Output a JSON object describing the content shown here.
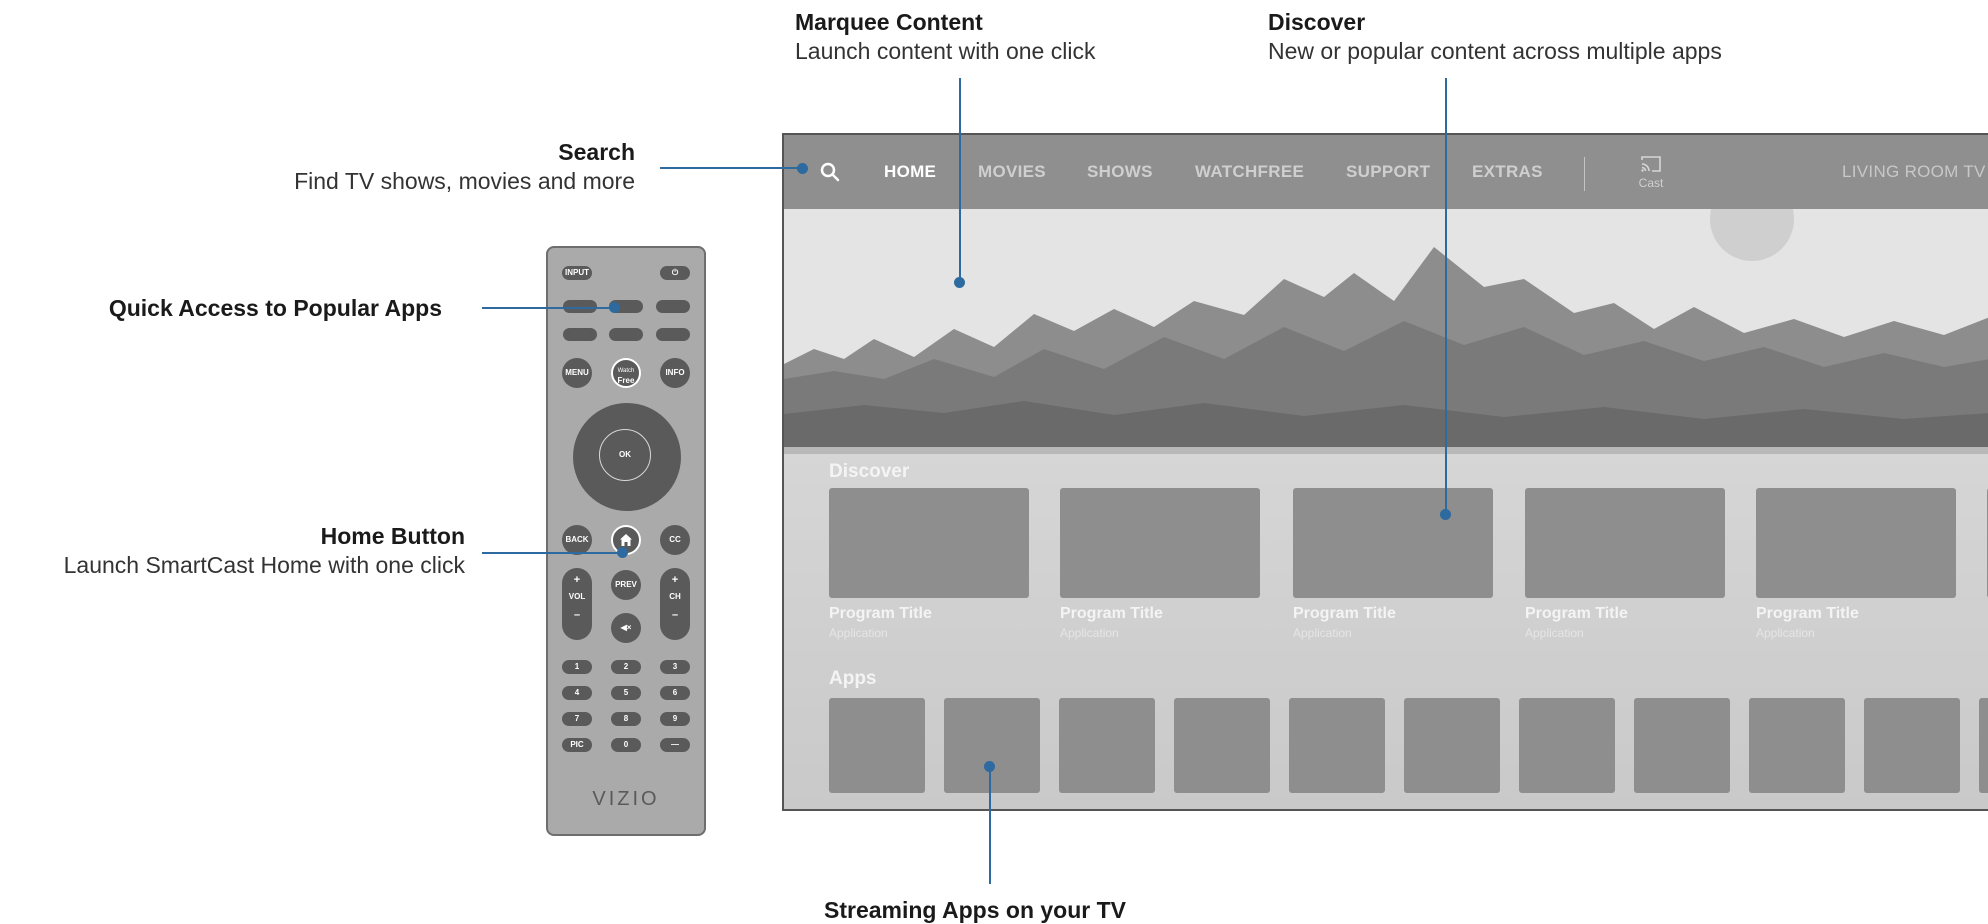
{
  "callouts": {
    "marquee": {
      "title": "Marquee Content",
      "subtitle": "Launch content with one click"
    },
    "discover": {
      "title": "Discover",
      "subtitle": "New or popular content across multiple apps"
    },
    "search": {
      "title": "Search",
      "subtitle": "Find TV shows, movies and more"
    },
    "quick_access": {
      "title": "Quick Access to Popular Apps"
    },
    "home_button": {
      "title": "Home Button",
      "subtitle": "Launch SmartCast Home with one click"
    },
    "streaming_apps": {
      "title": "Streaming Apps on your TV"
    }
  },
  "tv": {
    "nav": {
      "items": [
        "HOME",
        "MOVIES",
        "SHOWS",
        "WATCHFREE",
        "SUPPORT",
        "EXTRAS"
      ],
      "active": "HOME",
      "cast_label": "Cast",
      "device_name": "LIVING ROOM TV"
    },
    "discover": {
      "label": "Discover",
      "cards": [
        {
          "title": "Program Title",
          "app": "Application"
        },
        {
          "title": "Program Title",
          "app": "Application"
        },
        {
          "title": "Program Title",
          "app": "Application"
        },
        {
          "title": "Program Title",
          "app": "Application"
        },
        {
          "title": "Program Title",
          "app": "Application"
        }
      ]
    },
    "apps": {
      "label": "Apps"
    }
  },
  "remote": {
    "input": "INPUT",
    "power": "⏻",
    "menu": "MENU",
    "watchfree_top": "Watch",
    "watchfree_bottom": "Free",
    "info": "INFO",
    "ok": "OK",
    "back": "BACK",
    "cc": "CC",
    "prev": "PREV",
    "vol_plus": "+",
    "vol": "VOL",
    "vol_minus": "–",
    "ch_plus": "+",
    "ch": "CH",
    "ch_minus": "–",
    "mute": "◀×",
    "keys": [
      "1",
      "2",
      "3",
      "4",
      "5",
      "6",
      "7",
      "8",
      "9",
      "PIC",
      "0",
      "—"
    ],
    "brand": "VIZIO"
  },
  "colors": {
    "accent": "#2d6a9f",
    "nav_bg": "#8f8f8f",
    "tile": "#8e8e8e"
  }
}
